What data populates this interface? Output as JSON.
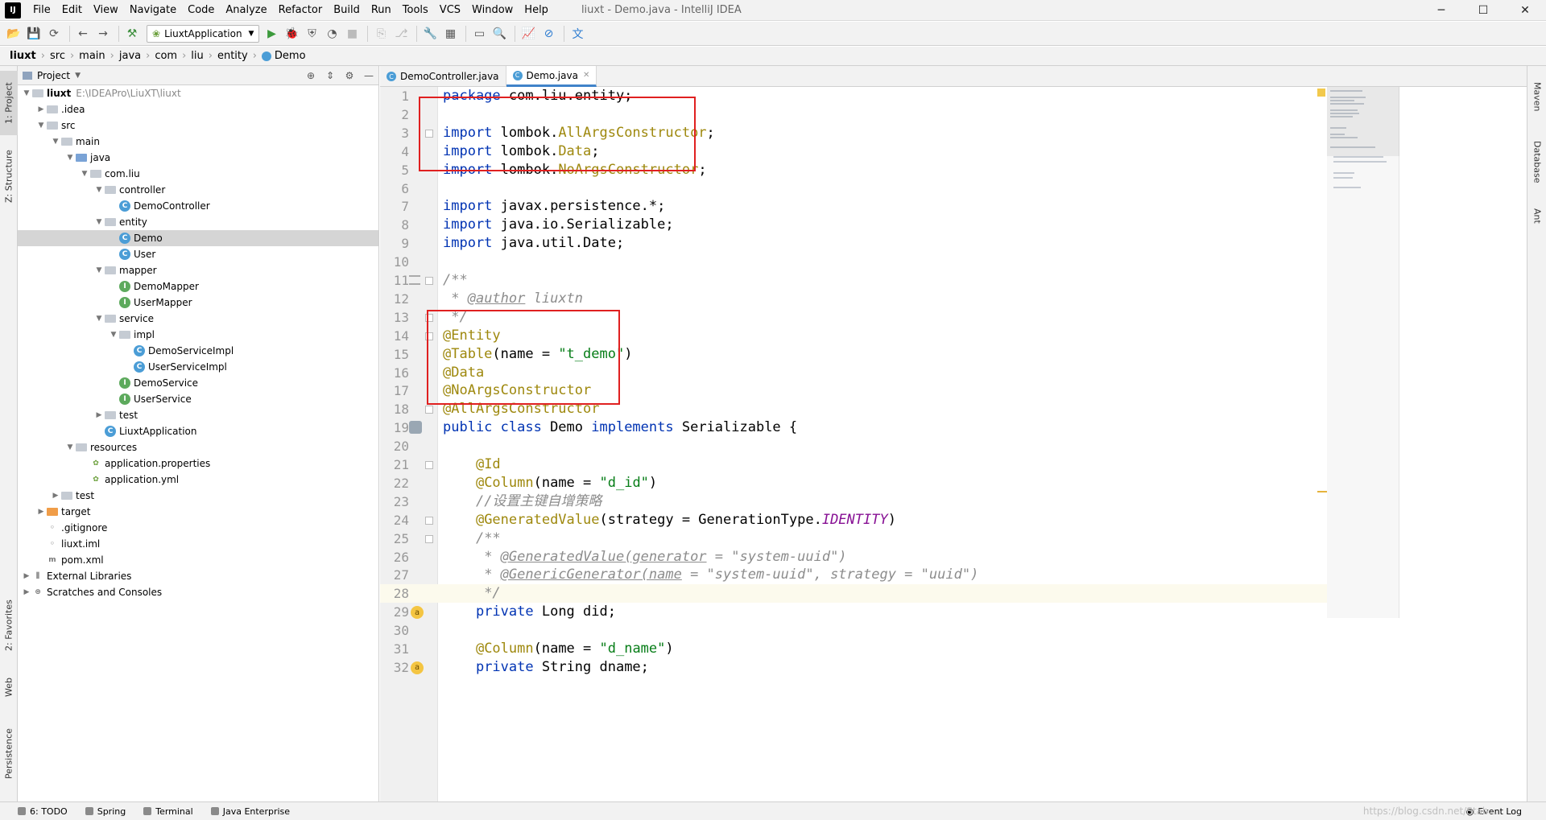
{
  "window": {
    "title": "liuxt - Demo.java - IntelliJ IDEA",
    "logo": "IJ",
    "controls": {
      "minimize": "─",
      "maximize": "☐",
      "close": "✕"
    }
  },
  "menu": [
    "File",
    "Edit",
    "View",
    "Navigate",
    "Code",
    "Analyze",
    "Refactor",
    "Build",
    "Run",
    "Tools",
    "VCS",
    "Window",
    "Help"
  ],
  "toolbar": {
    "run_config": "LiuxtApplication"
  },
  "breadcrumb": [
    "liuxt",
    "src",
    "main",
    "java",
    "com",
    "liu",
    "entity",
    "Demo"
  ],
  "left_tabs": [
    "1: Project",
    "Z: Structure",
    "2: Favorites",
    "Web",
    "Persistence"
  ],
  "right_tabs": [
    "Maven",
    "Database",
    "Ant"
  ],
  "project_panel": {
    "title": "Project",
    "tree": [
      {
        "label": "liuxt",
        "path": "E:\\IDEAPro\\LiuXT\\liuxt",
        "depth": 0,
        "icon": "folder",
        "expanded": true,
        "bold": true
      },
      {
        "label": ".idea",
        "depth": 1,
        "icon": "folder",
        "expanded": false
      },
      {
        "label": "src",
        "depth": 1,
        "icon": "folder",
        "expanded": true
      },
      {
        "label": "main",
        "depth": 2,
        "icon": "folder",
        "expanded": true
      },
      {
        "label": "java",
        "depth": 3,
        "icon": "folder-blue",
        "expanded": true
      },
      {
        "label": "com.liu",
        "depth": 4,
        "icon": "folder",
        "expanded": true
      },
      {
        "label": "controller",
        "depth": 5,
        "icon": "folder",
        "expanded": true
      },
      {
        "label": "DemoController",
        "depth": 6,
        "icon": "class"
      },
      {
        "label": "entity",
        "depth": 5,
        "icon": "folder",
        "expanded": true
      },
      {
        "label": "Demo",
        "depth": 6,
        "icon": "class",
        "selected": true
      },
      {
        "label": "User",
        "depth": 6,
        "icon": "class"
      },
      {
        "label": "mapper",
        "depth": 5,
        "icon": "folder",
        "expanded": true
      },
      {
        "label": "DemoMapper",
        "depth": 6,
        "icon": "interface"
      },
      {
        "label": "UserMapper",
        "depth": 6,
        "icon": "interface"
      },
      {
        "label": "service",
        "depth": 5,
        "icon": "folder",
        "expanded": true
      },
      {
        "label": "impl",
        "depth": 6,
        "icon": "folder",
        "expanded": true
      },
      {
        "label": "DemoServiceImpl",
        "depth": 7,
        "icon": "class"
      },
      {
        "label": "UserServiceImpl",
        "depth": 7,
        "icon": "class"
      },
      {
        "label": "DemoService",
        "depth": 6,
        "icon": "interface"
      },
      {
        "label": "UserService",
        "depth": 6,
        "icon": "interface"
      },
      {
        "label": "test",
        "depth": 5,
        "icon": "folder",
        "expanded": false
      },
      {
        "label": "LiuxtApplication",
        "depth": 5,
        "icon": "class"
      },
      {
        "label": "resources",
        "depth": 3,
        "icon": "folder",
        "expanded": true
      },
      {
        "label": "application.properties",
        "depth": 4,
        "icon": "resource"
      },
      {
        "label": "application.yml",
        "depth": 4,
        "icon": "resource"
      },
      {
        "label": "test",
        "depth": 2,
        "icon": "folder",
        "expanded": false
      },
      {
        "label": "target",
        "depth": 1,
        "icon": "folder-orange",
        "expanded": false
      },
      {
        "label": ".gitignore",
        "depth": 1,
        "icon": "file"
      },
      {
        "label": "liuxt.iml",
        "depth": 1,
        "icon": "file"
      },
      {
        "label": "pom.xml",
        "depth": 1,
        "icon": "maven"
      },
      {
        "label": "External Libraries",
        "depth": 0,
        "icon": "library",
        "expanded": false
      },
      {
        "label": "Scratches and Consoles",
        "depth": 0,
        "icon": "scratch",
        "expanded": false
      }
    ]
  },
  "editor_tabs": [
    {
      "label": "DemoController.java",
      "active": false
    },
    {
      "label": "Demo.java",
      "active": true
    }
  ],
  "code_lines": [
    {
      "n": "1",
      "tokens": [
        [
          "kw",
          "package"
        ],
        [
          "p",
          " com.liu.entity;"
        ]
      ]
    },
    {
      "n": "2",
      "tokens": []
    },
    {
      "n": "3",
      "tokens": [
        [
          "kw",
          "import"
        ],
        [
          "p",
          " lombok."
        ],
        [
          "lombok",
          "AllArgsConstructor"
        ],
        [
          "p",
          ";"
        ]
      ]
    },
    {
      "n": "4",
      "tokens": [
        [
          "kw",
          "import"
        ],
        [
          "p",
          " lombok."
        ],
        [
          "lombok",
          "Data"
        ],
        [
          "p",
          ";"
        ]
      ]
    },
    {
      "n": "5",
      "tokens": [
        [
          "kw",
          "import"
        ],
        [
          "p",
          " lombok."
        ],
        [
          "lombok",
          "NoArgsConstructor"
        ],
        [
          "p",
          ";"
        ]
      ]
    },
    {
      "n": "6",
      "tokens": []
    },
    {
      "n": "7",
      "tokens": [
        [
          "kw",
          "import"
        ],
        [
          "p",
          " javax.persistence.*;"
        ]
      ]
    },
    {
      "n": "8",
      "tokens": [
        [
          "kw",
          "import"
        ],
        [
          "p",
          " java.io.Serializable;"
        ]
      ]
    },
    {
      "n": "9",
      "tokens": [
        [
          "kw",
          "import"
        ],
        [
          "p",
          " java.util.Date;"
        ]
      ]
    },
    {
      "n": "10",
      "tokens": []
    },
    {
      "n": "11",
      "tokens": [
        [
          "cmt",
          "/**"
        ]
      ]
    },
    {
      "n": "12",
      "tokens": [
        [
          "cmt",
          " * "
        ],
        [
          "cmtu",
          "@author"
        ],
        [
          "cmt",
          " liuxtn"
        ]
      ]
    },
    {
      "n": "13",
      "tokens": [
        [
          "cmt",
          " */"
        ]
      ]
    },
    {
      "n": "14",
      "tokens": [
        [
          "ann",
          "@Entity"
        ]
      ]
    },
    {
      "n": "15",
      "tokens": [
        [
          "ann",
          "@Table"
        ],
        [
          "p",
          "(name = "
        ],
        [
          "str",
          "\"t_demo\""
        ],
        [
          "p",
          ")"
        ]
      ]
    },
    {
      "n": "16",
      "tokens": [
        [
          "ann",
          "@Data"
        ]
      ]
    },
    {
      "n": "17",
      "tokens": [
        [
          "ann",
          "@NoArgsConstructor"
        ]
      ]
    },
    {
      "n": "18",
      "tokens": [
        [
          "ann",
          "@AllArgsConstructor"
        ]
      ]
    },
    {
      "n": "19",
      "tokens": [
        [
          "kw",
          "public class"
        ],
        [
          "p",
          " Demo "
        ],
        [
          "kw",
          "implements"
        ],
        [
          "p",
          " Serializable {"
        ]
      ]
    },
    {
      "n": "20",
      "tokens": []
    },
    {
      "n": "21",
      "tokens": [
        [
          "p",
          "    "
        ],
        [
          "ann",
          "@Id"
        ]
      ]
    },
    {
      "n": "22",
      "tokens": [
        [
          "p",
          "    "
        ],
        [
          "ann",
          "@Column"
        ],
        [
          "p",
          "(name = "
        ],
        [
          "str",
          "\"d_id\""
        ],
        [
          "p",
          ")"
        ]
      ]
    },
    {
      "n": "23",
      "tokens": [
        [
          "p",
          "    "
        ],
        [
          "cmt",
          "//设置主键自增策略"
        ]
      ]
    },
    {
      "n": "24",
      "tokens": [
        [
          "p",
          "    "
        ],
        [
          "ann",
          "@GeneratedValue"
        ],
        [
          "p",
          "(strategy = GenerationType."
        ],
        [
          "cn",
          "IDENTITY"
        ],
        [
          "p",
          ")"
        ]
      ]
    },
    {
      "n": "25",
      "tokens": [
        [
          "p",
          "    "
        ],
        [
          "cmt",
          "/**"
        ]
      ]
    },
    {
      "n": "26",
      "tokens": [
        [
          "p",
          "    "
        ],
        [
          "cmt",
          " * "
        ],
        [
          "cmtu",
          "@GeneratedValue(generator"
        ],
        [
          "cmt",
          " = \"system-uuid\")"
        ]
      ]
    },
    {
      "n": "27",
      "tokens": [
        [
          "p",
          "    "
        ],
        [
          "cmt",
          " * "
        ],
        [
          "cmtu",
          "@GenericGenerator(name"
        ],
        [
          "cmt",
          " = \"system-uuid\", strategy = \"uuid\")"
        ]
      ]
    },
    {
      "n": "28",
      "tokens": [
        [
          "p",
          "    "
        ],
        [
          "cmt",
          " */"
        ]
      ],
      "current": true
    },
    {
      "n": "29",
      "tokens": [
        [
          "p",
          "    "
        ],
        [
          "kw",
          "private"
        ],
        [
          "p",
          " Long did;"
        ]
      ]
    },
    {
      "n": "30",
      "tokens": []
    },
    {
      "n": "31",
      "tokens": [
        [
          "p",
          "    "
        ],
        [
          "ann",
          "@Column"
        ],
        [
          "p",
          "(name = "
        ],
        [
          "str",
          "\"d_name\""
        ],
        [
          "p",
          ")"
        ]
      ]
    },
    {
      "n": "32",
      "tokens": [
        [
          "p",
          "    "
        ],
        [
          "kw",
          "private"
        ],
        [
          "p",
          " String dname;"
        ]
      ]
    }
  ],
  "status_bar": {
    "items": [
      "6: TODO",
      "Spring",
      "Terminal",
      "Java Enterprise"
    ],
    "event_log": "Event Log"
  },
  "watermark": "https://blog.csdn.net/Stab..."
}
